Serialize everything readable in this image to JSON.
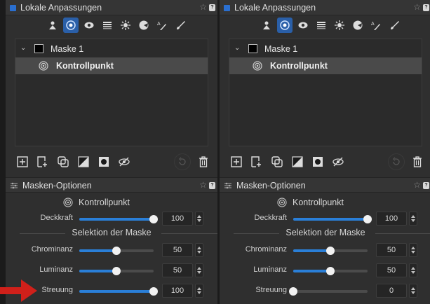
{
  "left": {
    "header": {
      "title": "Lokale Anpassungen",
      "help": "?"
    },
    "mask": {
      "name": "Maske 1",
      "item": "Kontrollpunkt"
    },
    "options": {
      "title": "Masken-Optionen",
      "help": "?",
      "control_point_label": "Kontrollpunkt",
      "opacity": {
        "label": "Deckkraft",
        "value": "100",
        "level": 1.0
      },
      "selection_title": "Selektion der Maske",
      "chroma": {
        "label": "Chrominanz",
        "value": "50",
        "level": 0.5
      },
      "luminance": {
        "label": "Luminanz",
        "value": "50",
        "level": 0.5
      },
      "spread": {
        "label": "Streuung",
        "value": "100",
        "level": 1.0
      }
    }
  },
  "right": {
    "header": {
      "title": "Lokale Anpassungen",
      "help": "?"
    },
    "mask": {
      "name": "Maske 1",
      "item": "Kontrollpunkt"
    },
    "options": {
      "title": "Masken-Optionen",
      "help": "?",
      "control_point_label": "Kontrollpunkt",
      "opacity": {
        "label": "Deckkraft",
        "value": "100",
        "level": 1.0
      },
      "selection_title": "Selektion der Maske",
      "chroma": {
        "label": "Chrominanz",
        "value": "50",
        "level": 0.5
      },
      "luminance": {
        "label": "Luminanz",
        "value": "50",
        "level": 0.5
      },
      "spread": {
        "label": "Streuung",
        "value": "0",
        "level": 0.0
      }
    }
  },
  "toolbar_icons": [
    "person-mask-icon",
    "control-point-icon",
    "eye-icon",
    "gradient-icon",
    "auto-mask-icon",
    "color-wheel-icon",
    "text-brush-icon",
    "brush-icon"
  ],
  "mask_tool_icons": [
    "add-mask-icon",
    "add-new-icon",
    "duplicate-icon",
    "invert-icon",
    "circle-mask-icon",
    "visibility-icon"
  ],
  "colors": {
    "accent": "#2a7fd8",
    "active_tool": "#2a5fa8",
    "arrow": "#d0201a",
    "panel_bg": "#2f2f2f"
  }
}
